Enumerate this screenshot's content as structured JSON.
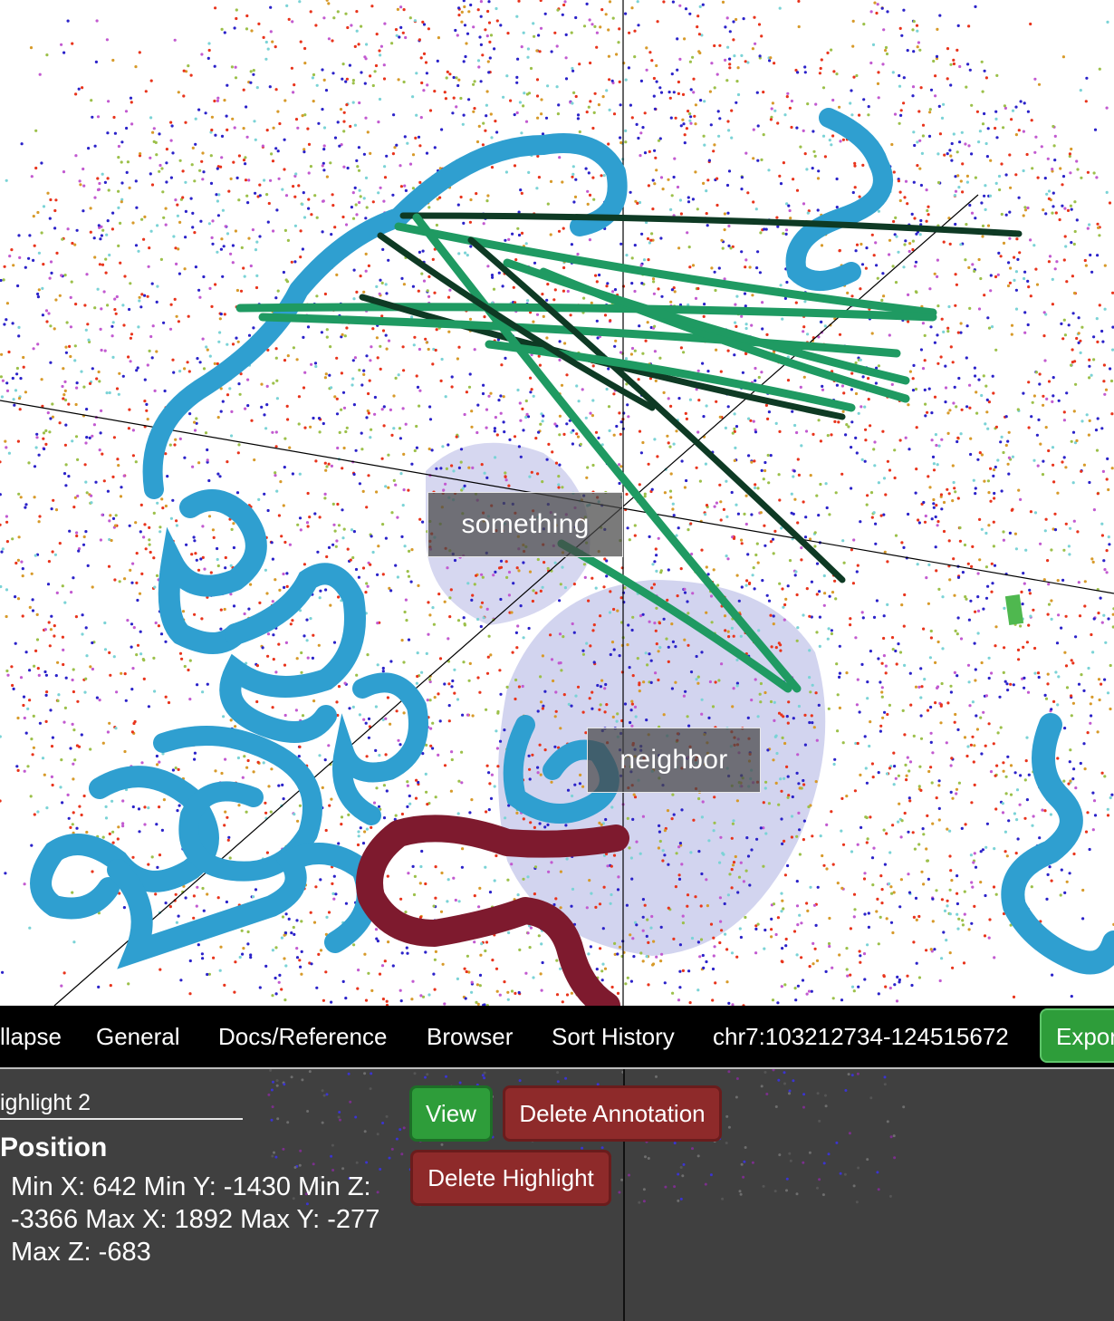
{
  "viewer": {
    "labels": {
      "something": "something",
      "neighbor": "neighbor"
    },
    "colors": {
      "chromatin_tube": "#2f9fd0",
      "selected_tube": "#7e1a2e",
      "strands": "#1f9a62",
      "highlight_region": "#6a6fc9",
      "axis": "#000000"
    }
  },
  "menubar": {
    "items": [
      "llapse",
      "General",
      "Docs/Reference",
      "Browser",
      "Sort History",
      "chr7:103212734-124515672"
    ],
    "export_label": "Expor"
  },
  "panel": {
    "highlight_name": "ighlight 2",
    "position_title": "Position",
    "position_text": "Min X: 642 Min Y: -1430 Min Z: -3366 Max X: 1892 Max Y: -277 Max Z: -683",
    "buttons": {
      "view": "View",
      "delete_annotation": "Delete Annotation",
      "delete_highlight": "Delete Highlight"
    }
  }
}
